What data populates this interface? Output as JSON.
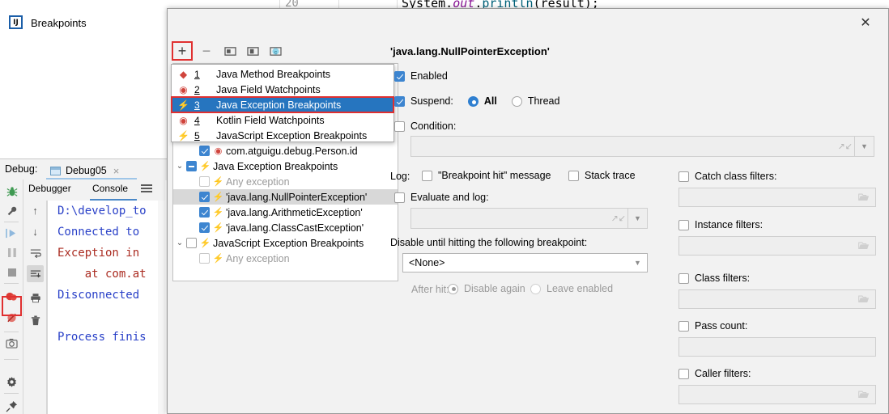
{
  "editor": {
    "line_number": "20",
    "code_parts": [
      {
        "text": "System.",
        "cls": "c-plain"
      },
      {
        "text": "out",
        "cls": "c-ital"
      },
      {
        "text": ".",
        "cls": "c-plain"
      },
      {
        "text": "println",
        "cls": "c-meth"
      },
      {
        "text": "(result);",
        "cls": "c-paren"
      }
    ],
    "code_full": "System.out.println(result);"
  },
  "debug_tool": {
    "label": "Debug:",
    "tab_name": "Debug05",
    "tab_close": "×",
    "tabs": [
      {
        "label": "Debugger",
        "active": false
      },
      {
        "label": "Console",
        "active": true
      }
    ],
    "console_lines": [
      {
        "text": "D:\\develop_to",
        "cls": "cl-blue"
      },
      {
        "text": "Connected to",
        "cls": "cl-blue"
      },
      {
        "text": "Exception in",
        "cls": "cl-red"
      },
      {
        "text": "    at com.at",
        "cls": "cl-red"
      },
      {
        "text": "Disconnected",
        "cls": "cl-blue"
      },
      {
        "text": "Process finis",
        "cls": "cl-blue"
      }
    ],
    "rail_icons": [
      "bug-icon",
      "wrench-icon",
      "resume-icon",
      "pause-icon",
      "stop-icon",
      "view-breakpoints-icon",
      "mute-breakpoints-icon",
      "camera-icon",
      "settings-gear-icon",
      "pin-icon"
    ],
    "side_toolbar_icons": [
      "scroll-up-icon",
      "scroll-down-icon",
      "soft-wrap-icon",
      "scroll-to-end-icon",
      "print-icon",
      "trash-icon"
    ]
  },
  "dialog": {
    "title": "Breakpoints",
    "icon_name": "intellij-idea-icon",
    "close_label": "✕",
    "toolbar": [
      {
        "name": "add-breakpoint-button",
        "glyph": "+",
        "highlighted": true
      },
      {
        "name": "remove-breakpoint-button",
        "glyph": "−",
        "highlighted": false
      },
      {
        "name": "view-source-button",
        "glyph": "▣",
        "highlighted": false
      },
      {
        "name": "group-by-file-button",
        "glyph": "▤",
        "highlighted": false
      },
      {
        "name": "group-by-class-button",
        "glyph": "Ⓒ",
        "highlighted": false
      }
    ],
    "menu": {
      "items": [
        {
          "num": "1",
          "label": "Java Method Breakpoints",
          "icon": "diamond-icon",
          "glyph": "◆",
          "selected": false
        },
        {
          "num": "2",
          "label": "Java Field Watchpoints",
          "icon": "eye-icon",
          "glyph": "◉",
          "selected": false
        },
        {
          "num": "3",
          "label": "Java Exception Breakpoints",
          "icon": "bolt-icon",
          "glyph": "⚡",
          "selected": true
        },
        {
          "num": "4",
          "label": "Kotlin Field Watchpoints",
          "icon": "eye-icon",
          "glyph": "◉",
          "selected": false
        },
        {
          "num": "5",
          "label": "JavaScript Exception Breakpoints",
          "icon": "bolt-icon",
          "glyph": "⚡",
          "selected": false
        }
      ]
    },
    "tree": {
      "rows": [
        {
          "indent": 1,
          "twisty": "",
          "check": "on",
          "icon": "eye-icon",
          "glyph": "◉",
          "label": "com.atguigu.debug.Person.id",
          "dim": false,
          "hl": false
        },
        {
          "indent": 0,
          "twisty": "⌄",
          "check": "partial",
          "icon": "bolt-icon",
          "glyph": "⚡",
          "label": "Java Exception Breakpoints",
          "dim": false,
          "hl": false
        },
        {
          "indent": 1,
          "twisty": "",
          "check": "off-dim",
          "icon": "bolt-dim-icon",
          "glyph": "⚡",
          "label": "Any exception",
          "dim": true,
          "hl": false
        },
        {
          "indent": 1,
          "twisty": "",
          "check": "on",
          "icon": "bolt-icon",
          "glyph": "⚡",
          "label": "'java.lang.NullPointerException'",
          "dim": false,
          "hl": true
        },
        {
          "indent": 1,
          "twisty": "",
          "check": "on",
          "icon": "bolt-icon",
          "glyph": "⚡",
          "label": "'java.lang.ArithmeticException'",
          "dim": false,
          "hl": false
        },
        {
          "indent": 1,
          "twisty": "",
          "check": "on",
          "icon": "bolt-icon",
          "glyph": "⚡",
          "label": "'java.lang.ClassCastException'",
          "dim": false,
          "hl": false
        },
        {
          "indent": 0,
          "twisty": "⌄",
          "check": "off",
          "icon": "bolt-icon",
          "glyph": "⚡",
          "label": "JavaScript Exception Breakpoints",
          "dim": false,
          "hl": false
        },
        {
          "indent": 1,
          "twisty": "",
          "check": "off-dim",
          "icon": "bolt-dim-icon",
          "glyph": "⚡",
          "label": "Any exception",
          "dim": true,
          "hl": false
        }
      ]
    },
    "details": {
      "header": "'java.lang.NullPointerException'",
      "enabled": {
        "label": "Enabled",
        "checked": true
      },
      "suspend": {
        "label": "Suspend:",
        "checked": true,
        "all": {
          "label": "All",
          "selected": true
        },
        "thread": {
          "label": "Thread",
          "selected": false
        }
      },
      "condition": {
        "label": "Condition:",
        "checked": false,
        "value": ""
      },
      "log": {
        "label": "Log:",
        "breakpoint_hit": {
          "label": "\"Breakpoint hit\" message",
          "checked": false
        },
        "stack_trace": {
          "label": "Stack trace",
          "checked": false
        }
      },
      "evaluate_and_log": {
        "label": "Evaluate and log:",
        "checked": false,
        "value": ""
      },
      "disable_until": {
        "label": "Disable until hitting the following breakpoint:",
        "value": "<None>",
        "after_hit_label": "After hit:",
        "disable_again": {
          "label": "Disable again",
          "selected": true
        },
        "leave_enabled": {
          "label": "Leave enabled",
          "selected": false
        }
      },
      "filters": [
        {
          "name": "catch-class-filters",
          "label": "Catch class filters:",
          "checked": false,
          "value": "",
          "has_folder": true
        },
        {
          "name": "instance-filters",
          "label": "Instance filters:",
          "checked": false,
          "value": "",
          "has_folder": true
        },
        {
          "name": "class-filters",
          "label": "Class filters:",
          "checked": false,
          "value": "",
          "has_folder": true
        },
        {
          "name": "pass-count",
          "label": "Pass count:",
          "checked": false,
          "value": "",
          "has_folder": false
        },
        {
          "name": "caller-filters",
          "label": "Caller filters:",
          "checked": false,
          "value": "",
          "has_folder": true
        }
      ]
    }
  },
  "colors": {
    "accent_blue": "#2675bf",
    "highlight_red": "#e03030",
    "checkbox_blue": "#3d85d0",
    "bolt_red": "#e8483c",
    "dialog_bg": "#f2f2f2",
    "console_blue": "#2a41c8",
    "console_red": "#aa2b20"
  }
}
